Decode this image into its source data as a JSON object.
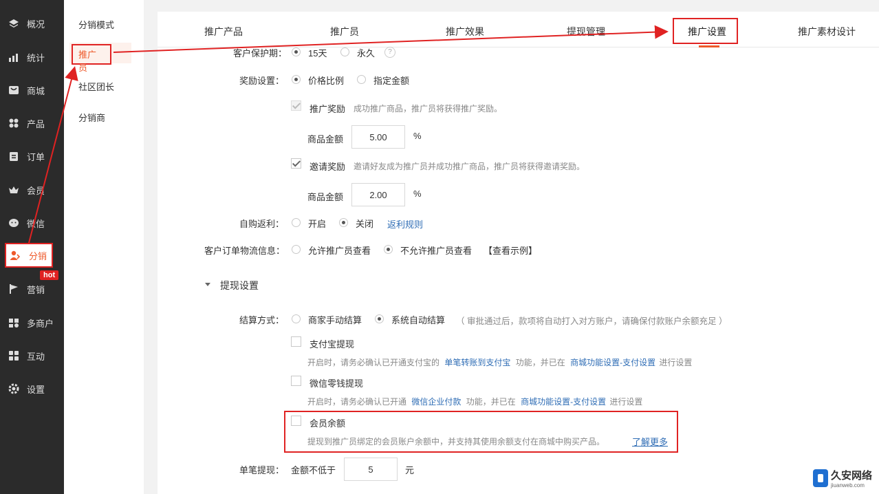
{
  "sidebar": {
    "items": [
      {
        "label": "概况",
        "icon": "layers-icon"
      },
      {
        "label": "统计",
        "icon": "chart-icon"
      },
      {
        "label": "商城",
        "icon": "shop-icon"
      },
      {
        "label": "产品",
        "icon": "grid-icon"
      },
      {
        "label": "订单",
        "icon": "order-icon"
      },
      {
        "label": "会员",
        "icon": "crown-icon"
      },
      {
        "label": "微信",
        "icon": "wechat-icon"
      },
      {
        "label": "分销",
        "icon": "users-icon"
      },
      {
        "label": "营销",
        "icon": "flag-icon"
      },
      {
        "label": "多商户",
        "icon": "merchant-icon"
      },
      {
        "label": "互动",
        "icon": "interact-icon"
      },
      {
        "label": "设置",
        "icon": "gear-icon"
      }
    ],
    "hot_badge": "hot"
  },
  "subnav": {
    "items": [
      "分销模式",
      "推广员",
      "社区团长",
      "分销商"
    ]
  },
  "tabs": [
    "推广产品",
    "推广员",
    "推广效果",
    "提现管理",
    "推广设置",
    "推广素材设计"
  ],
  "form": {
    "protect": {
      "label": "客户保护期：",
      "opt1": "15天",
      "opt2": "永久",
      "help": "?"
    },
    "reward": {
      "label": "奖励设置：",
      "opt1": "价格比例",
      "opt2": "指定金额"
    },
    "promo_reward": {
      "label": "推广奖励",
      "hint": "成功推广商品，推广员将获得推广奖励。",
      "amount_label": "商品金额",
      "amount": "5.00",
      "unit": "%"
    },
    "invite_reward": {
      "label": "邀请奖励",
      "hint": "邀请好友成为推广员并成功推广商品，推广员将获得邀请奖励。",
      "amount_label": "商品金额",
      "amount": "2.00",
      "unit": "%"
    },
    "self_buy": {
      "label": "自购返利：",
      "opt1": "开启",
      "opt2": "关闭",
      "link": "返利规则"
    },
    "logistics": {
      "label": "客户订单物流信息：",
      "opt1": "允许推广员查看",
      "opt2": "不允许推广员查看",
      "link": "【查看示例】"
    }
  },
  "withdraw": {
    "title": "提现设置",
    "settle": {
      "label": "结算方式：",
      "opt1": "商家手动结算",
      "opt2": "系统自动结算",
      "note": "（ 审批通过后，款项将自动打入对方账户，请确保付款账户余额充足 ）"
    },
    "alipay": {
      "label": "支付宝提现",
      "hint_a": "开启时，请务必确认已开通支付宝的",
      "link_a": "单笔转账到支付宝",
      "hint_b": "功能，并已在",
      "link_b": "商城功能设置-支付设置",
      "hint_c": "进行设置"
    },
    "wechat": {
      "label": "微信零钱提现",
      "hint_a": "开启时，请务必确认已开通",
      "link_a": "微信企业付款",
      "hint_b": "功能，并已在",
      "link_b": "商城功能设置-支付设置",
      "hint_c": "进行设置"
    },
    "balance": {
      "label": "会员余额",
      "hint": "提现到推广员绑定的会员账户余额中，并支持其使用余额支付在商城中购买产品。",
      "link": "了解更多"
    },
    "single": {
      "label": "单笔提现：",
      "prefix": "金额不低于",
      "value": "5",
      "unit": "元"
    }
  },
  "watermark": {
    "title": "久安网络",
    "url": "jiuanweb.com"
  }
}
